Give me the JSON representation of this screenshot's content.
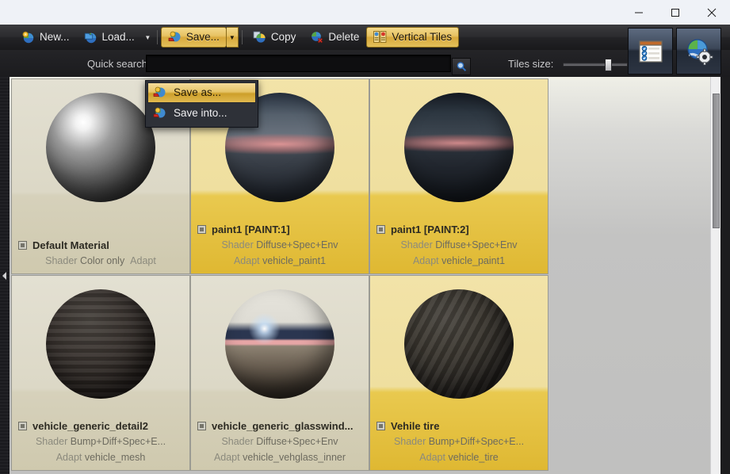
{
  "window": {
    "controls": [
      {
        "name": "minimize",
        "glyph": "minimize-icon"
      },
      {
        "name": "maximize",
        "glyph": "maximize-icon"
      },
      {
        "name": "close",
        "glyph": "close-icon"
      }
    ]
  },
  "toolbar": {
    "buttons": [
      {
        "label": "New...",
        "icon": "new-material-icon",
        "active": false,
        "split": false
      },
      {
        "label": "Load...",
        "icon": "load-material-icon",
        "active": false,
        "split": true
      },
      {
        "label": "Save...",
        "icon": "save-material-icon",
        "active": true,
        "split": true
      },
      {
        "label": "Copy",
        "icon": "copy-icon",
        "active": false,
        "split": false
      },
      {
        "label": "Delete",
        "icon": "delete-icon",
        "active": false,
        "split": false
      },
      {
        "label": "Vertical Tiles",
        "icon": "vertical-tiles-icon",
        "active": true,
        "split": false
      }
    ],
    "right_buttons": [
      {
        "name": "properties-list-button",
        "icon": "checklist-icon"
      },
      {
        "name": "settings-button",
        "icon": "globe-gear-icon"
      }
    ]
  },
  "search": {
    "label": "Quick search",
    "value": "",
    "placeholder": "",
    "button_icon": "magnifier-icon"
  },
  "tiles_size": {
    "label": "Tiles size:",
    "value": 72,
    "min": 0,
    "max": 100
  },
  "menu": {
    "items": [
      {
        "label": "Save as...",
        "icon": "save-as-icon",
        "selected": true
      },
      {
        "label": "Save into...",
        "icon": "save-into-icon",
        "selected": false
      }
    ]
  },
  "materials": [
    {
      "name": "Default Material",
      "shader_key": "Shader",
      "shader_value": "Color only",
      "adapt_key": "Adapt",
      "adapt_value": "",
      "selected": false,
      "preview": "chrome-sphere"
    },
    {
      "name": "paint1  [PAINT:1]",
      "shader_key": "Shader",
      "shader_value": "Diffuse+Spec+Env",
      "adapt_key": "Adapt",
      "adapt_value": "vehicle_paint1",
      "selected": true,
      "preview": "dark-paint-sphere"
    },
    {
      "name": "paint1  [PAINT:2]",
      "shader_key": "Shader",
      "shader_value": "Diffuse+Spec+Env",
      "adapt_key": "Adapt",
      "adapt_value": "vehicle_paint1",
      "selected": true,
      "preview": "dark-paint-sphere-2"
    },
    {
      "name": "vehicle_generic_detail2",
      "shader_key": "Shader",
      "shader_value": "Bump+Diff+Spec+E...",
      "adapt_key": "Adapt",
      "adapt_value": "vehicle_mesh",
      "selected": false,
      "preview": "detail-sphere"
    },
    {
      "name": "vehicle_generic_glasswind...",
      "shader_key": "Shader",
      "shader_value": "Diffuse+Spec+Env",
      "adapt_key": "Adapt",
      "adapt_value": "vehicle_vehglass_inner",
      "selected": false,
      "preview": "glass-sphere"
    },
    {
      "name": "Vehile tire",
      "shader_key": "Shader",
      "shader_value": "Bump+Diff+Spec+E...",
      "adapt_key": "Adapt",
      "adapt_value": "vehicle_tire",
      "selected": true,
      "preview": "tire-sphere"
    }
  ],
  "colors": {
    "accent_gold": "#e6c468",
    "tile_selected": "#e9c94f",
    "tile_normal": "#dcd8c6",
    "toolbar_dark": "#2b2b2e",
    "panel_bg": "#c0c0bf"
  }
}
